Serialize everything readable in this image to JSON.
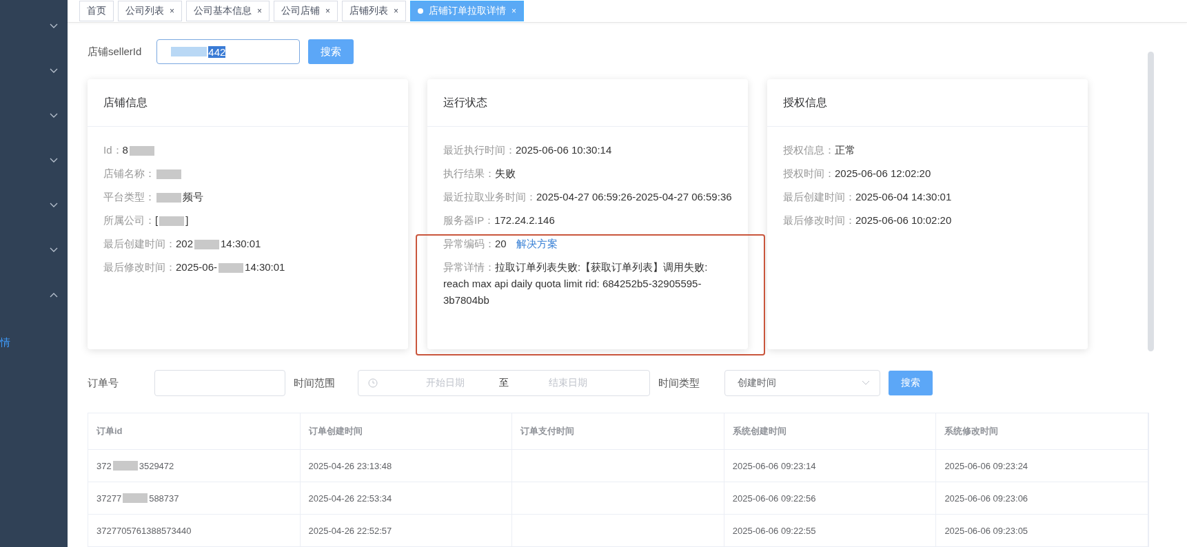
{
  "sidebar": {
    "items": [
      {
        "expanded": false
      },
      {
        "expanded": false
      },
      {
        "expanded": false
      },
      {
        "expanded": false
      },
      {
        "expanded": false
      },
      {
        "expanded": false
      },
      {
        "expanded": true
      }
    ],
    "partial_label": "情"
  },
  "tabs": [
    {
      "label": "首页",
      "selected": false
    },
    {
      "label": "公司列表",
      "close": "×",
      "selected": false
    },
    {
      "label": "公司基本信息",
      "close": "×",
      "selected": false
    },
    {
      "label": "公司店铺",
      "close": "×",
      "selected": false
    },
    {
      "label": "店铺列表",
      "close": "×",
      "selected": false
    },
    {
      "label": "店铺订单拉取详情",
      "close": "×",
      "selected": true
    }
  ],
  "seller_search": {
    "label": "店铺sellerId",
    "value_parts": [
      {
        "kind": "mask"
      },
      {
        "kind": "text",
        "text": "442"
      }
    ],
    "button": "搜索"
  },
  "cards": [
    {
      "title": "店铺信息",
      "fields": [
        {
          "label": "Id：",
          "parts": [
            {
              "kind": "text",
              "text": "8"
            },
            {
              "kind": "mask"
            }
          ]
        },
        {
          "label": "店铺名称：",
          "parts": [
            {
              "kind": "mask"
            }
          ]
        },
        {
          "label": "平台类型：",
          "parts": [
            {
              "kind": "mask"
            },
            {
              "kind": "text",
              "text": "频号"
            }
          ]
        },
        {
          "label": "所属公司：",
          "parts": [
            {
              "kind": "text",
              "text": "["
            },
            {
              "kind": "mask"
            },
            {
              "kind": "text",
              "text": "]"
            }
          ]
        },
        {
          "label": "最后创建时间：",
          "parts": [
            {
              "kind": "text",
              "text": "202"
            },
            {
              "kind": "mask"
            },
            {
              "kind": "text",
              "text": "14:30:01"
            }
          ]
        },
        {
          "label": "最后修改时间：",
          "parts": [
            {
              "kind": "text",
              "text": "2025-06-"
            },
            {
              "kind": "mask"
            },
            {
              "kind": "text",
              "text": "14:30:01"
            }
          ]
        }
      ]
    },
    {
      "title": "运行状态",
      "fields": [
        {
          "label": "最近执行时间：",
          "parts": [
            {
              "kind": "text",
              "text": "2025-06-06 10:30:14"
            }
          ]
        },
        {
          "label": "执行结果：",
          "parts": [
            {
              "kind": "text",
              "text": "失败"
            }
          ]
        },
        {
          "label": "最近拉取业务时间：",
          "parts": [
            {
              "kind": "text",
              "text": "2025-04-27 06:59:26-2025-04-27 06:59:36"
            }
          ]
        },
        {
          "label": "服务器IP：",
          "parts": [
            {
              "kind": "text",
              "text": "172.24.2.146"
            }
          ]
        },
        {
          "label": "异常编码：",
          "parts": [
            {
              "kind": "text",
              "text": "20"
            },
            {
              "kind": "link",
              "text": "解决方案"
            }
          ]
        },
        {
          "label": "异常详情：",
          "parts": [
            {
              "kind": "text",
              "text": "拉取订单列表失败:【获取订单列表】调用失败: reach max api daily quota limit rid: 684252b5-32905595-3b7804bb"
            }
          ]
        }
      ]
    },
    {
      "title": "授权信息",
      "fields": [
        {
          "label": "授权信息：",
          "parts": [
            {
              "kind": "text",
              "text": "正常"
            }
          ]
        },
        {
          "label": "授权时间：",
          "parts": [
            {
              "kind": "text",
              "text": "2025-06-06 12:02:20"
            }
          ]
        },
        {
          "label": "最后创建时间：",
          "parts": [
            {
              "kind": "text",
              "text": "2025-06-04 14:30:01"
            }
          ]
        },
        {
          "label": "最后修改时间：",
          "parts": [
            {
              "kind": "text",
              "text": "2025-06-06 10:02:20"
            }
          ]
        }
      ]
    }
  ],
  "filters": {
    "order_label": "订单号",
    "range_label": "时间范围",
    "start_placeholder": "开始日期",
    "separator": "至",
    "end_placeholder": "结束日期",
    "type_label": "时间类型",
    "type_value": "创建时间",
    "button": "搜索"
  },
  "table": {
    "columns": [
      "订单id",
      "订单创建时间",
      "订单支付时间",
      "系统创建时间",
      "系统修改时间"
    ],
    "rows": [
      {
        "cells": [
          {
            "parts": [
              {
                "kind": "text",
                "text": "372"
              },
              {
                "kind": "mask"
              },
              {
                "kind": "text",
                "text": "3529472"
              }
            ]
          },
          {
            "parts": [
              {
                "kind": "text",
                "text": "2025-04-26 23:13:48"
              }
            ]
          },
          {},
          {
            "parts": [
              {
                "kind": "text",
                "text": "2025-06-06 09:23:14"
              }
            ]
          },
          {
            "parts": [
              {
                "kind": "text",
                "text": "2025-06-06 09:23:24"
              }
            ]
          }
        ]
      },
      {
        "cells": [
          {
            "parts": [
              {
                "kind": "text",
                "text": "37277"
              },
              {
                "kind": "mask"
              },
              {
                "kind": "text",
                "text": "588737"
              }
            ]
          },
          {
            "parts": [
              {
                "kind": "text",
                "text": "2025-04-26 22:53:34"
              }
            ]
          },
          {},
          {
            "parts": [
              {
                "kind": "text",
                "text": "2025-06-06 09:22:56"
              }
            ]
          },
          {
            "parts": [
              {
                "kind": "text",
                "text": "2025-06-06 09:23:06"
              }
            ]
          }
        ]
      },
      {
        "cells": [
          {
            "parts": [
              {
                "kind": "text",
                "text": "3727705761388573440"
              }
            ]
          },
          {
            "parts": [
              {
                "kind": "text",
                "text": "2025-04-26 22:52:57"
              }
            ]
          },
          {},
          {
            "parts": [
              {
                "kind": "text",
                "text": "2025-06-06 09:22:55"
              }
            ]
          },
          {
            "parts": [
              {
                "kind": "text",
                "text": "2025-06-06 09:23:05"
              }
            ]
          }
        ]
      }
    ]
  }
}
